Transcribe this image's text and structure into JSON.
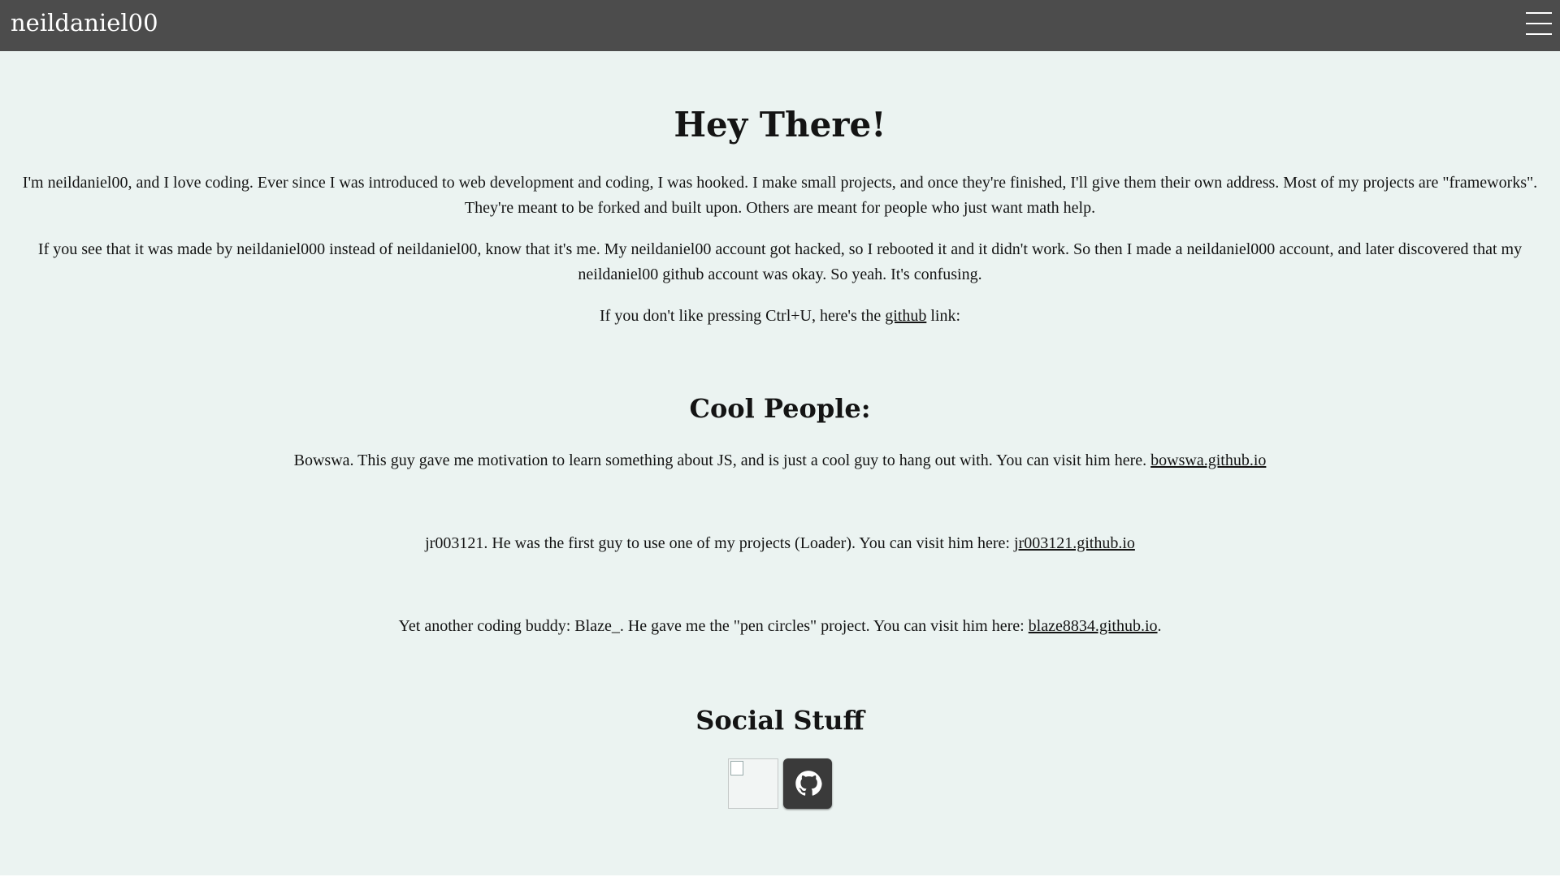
{
  "header": {
    "brand": "neildaniel00",
    "menu_icon": "hamburger-menu-icon"
  },
  "intro": {
    "title": "Hey There!",
    "p1": "I'm neildaniel00, and I love coding. Ever since I was introduced to web development and coding, I was hooked. I make small projects, and once they're finished, I'll give them their own address. Most of my projects are \"frameworks\". They're meant to be forked and built upon. Others are meant for people who just want math help.",
    "p2": "If you see that it was made by neildaniel000 instead of neildaniel00, know that it's me. My neildaniel00 account got hacked, so I rebooted it and it didn't work. So then I made a neildaniel000 account, and later discovered that my neildaniel00 github account was okay. So yeah. It's confusing.",
    "p3_before": "If you don't like pressing Ctrl+U, here's the ",
    "p3_link": "github",
    "p3_after": " link:"
  },
  "cool_people": {
    "title": "Cool People:",
    "items": [
      {
        "text": "Bowswa. This guy gave me motivation to learn something about JS, and is just a cool guy to hang out with. You can visit him here. ",
        "link": "bowswa.github.io",
        "after": ""
      },
      {
        "text": "jr003121. He was the first guy to use one of my projects (Loader). You can visit him here: ",
        "link": "jr003121.github.io",
        "after": ""
      },
      {
        "text": "Yet another coding buddy: Blaze_. He gave me the \"pen circles\" project. You can visit him here: ",
        "link": "blaze8834.github.io",
        "after": "."
      }
    ]
  },
  "social": {
    "title": "Social Stuff",
    "icons": [
      "broken-image-icon",
      "github-icon"
    ]
  },
  "colors": {
    "background": "#ebf3f1",
    "header": "#4c4c4c",
    "text": "#141414"
  }
}
